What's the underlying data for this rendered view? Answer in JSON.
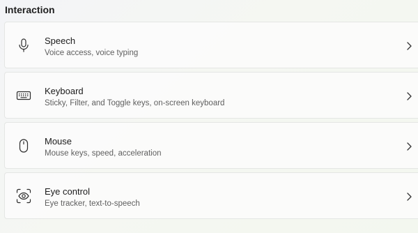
{
  "section": {
    "title": "Interaction"
  },
  "items": [
    {
      "title": "Speech",
      "description": "Voice access, voice typing",
      "icon": "microphone-icon"
    },
    {
      "title": "Keyboard",
      "description": "Sticky, Filter, and Toggle keys, on-screen keyboard",
      "icon": "keyboard-icon"
    },
    {
      "title": "Mouse",
      "description": "Mouse keys, speed, acceleration",
      "icon": "mouse-icon"
    },
    {
      "title": "Eye control",
      "description": "Eye tracker, text-to-speech",
      "icon": "eye-control-icon"
    }
  ],
  "colors": {
    "card_background": "#fcfcfc",
    "card_border": "#e4e6e4",
    "title_text": "#1b1b1b",
    "description_text": "#5f5f5f"
  }
}
